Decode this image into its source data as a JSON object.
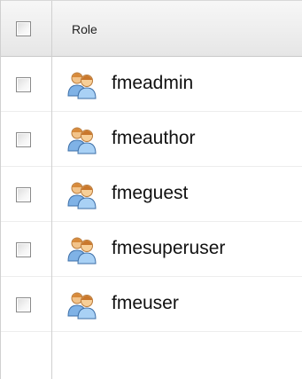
{
  "grid": {
    "header": {
      "role_label": "Role"
    },
    "rows": [
      {
        "name": "fmeadmin"
      },
      {
        "name": "fmeauthor"
      },
      {
        "name": "fmeguest"
      },
      {
        "name": "fmesuperuser"
      },
      {
        "name": "fmeuser"
      }
    ],
    "icon": "users-group-icon"
  }
}
